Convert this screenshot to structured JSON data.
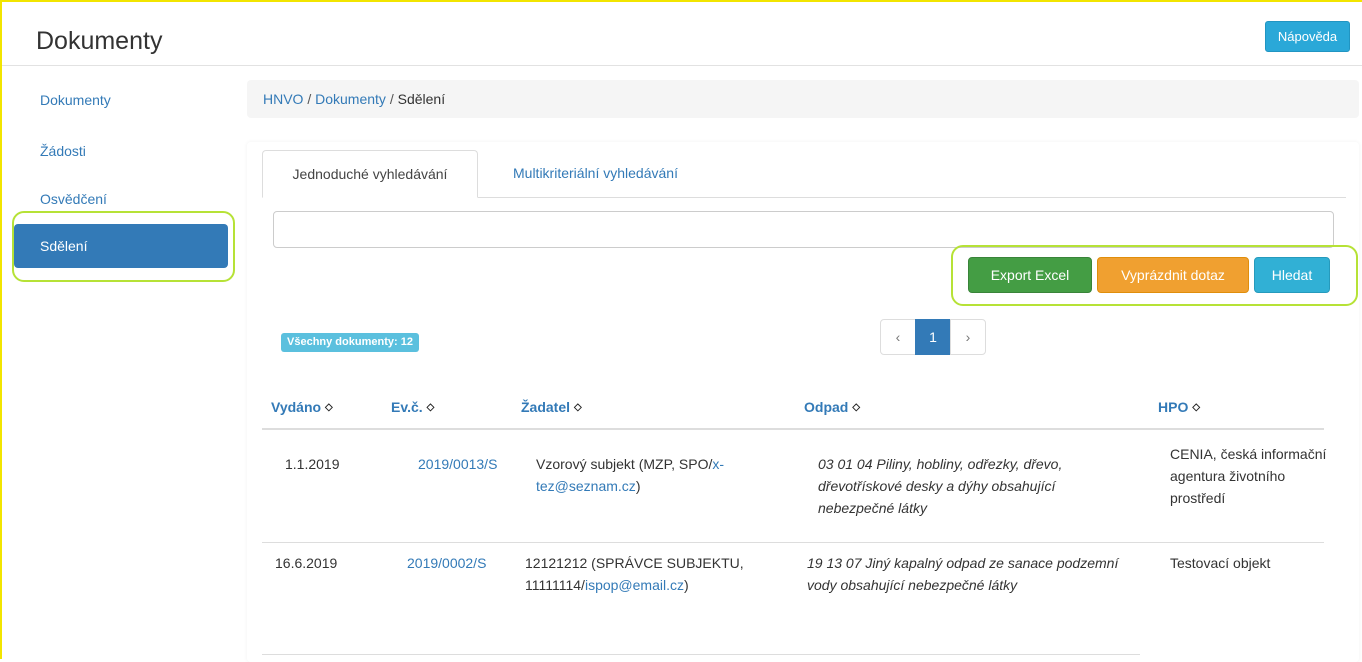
{
  "header": {
    "title": "Dokumenty",
    "help_label": "Nápověda"
  },
  "sidebar": {
    "items": [
      {
        "label": "Dokumenty"
      },
      {
        "label": "Žádosti"
      },
      {
        "label": "Osvědčení"
      },
      {
        "label": "Sdělení"
      }
    ]
  },
  "breadcrumb": {
    "root": "HNVO",
    "sep1": "/",
    "parent": "Dokumenty",
    "sep2": "/",
    "current": "Sdělení"
  },
  "tabs": [
    {
      "label": "Jednoduché vyhledávání",
      "active": true
    },
    {
      "label": "Multikriteriální vyhledávání",
      "active": false
    }
  ],
  "search": {
    "value": "",
    "placeholder": ""
  },
  "buttons": {
    "export": "Export Excel",
    "clear": "Vyprázdnit dotaz",
    "search": "Hledat"
  },
  "count_badge": "Všechny dokumenty: 12",
  "pagination": {
    "prev": "‹",
    "current": "1",
    "next": "›"
  },
  "table": {
    "columns": [
      "Vydáno",
      "Ev.č.",
      "Žadatel",
      "Odpad",
      "HPO"
    ],
    "sort_icon": "◇",
    "rows": [
      {
        "vydano": "1.1.2019",
        "evc": "2019/0013/S",
        "zadatel_text": "Vzorový subjekt (MZP, SPO/",
        "zadatel_email": "x-tez@seznam.cz",
        "zadatel_end": ")",
        "odpad": "03 01 04 Piliny, hobliny, odřezky, dřevo, dřevotřískové desky a dýhy obsahující nebezpečné látky",
        "hpo": "CENIA, česká informační agentura životního prostředí"
      },
      {
        "vydano": "16.6.2019",
        "evc": "2019/0002/S",
        "zadatel_text": "12121212 (SPRÁVCE SUBJEKTU, 11111114/",
        "zadatel_email": "ispop@email.cz",
        "zadatel_end": ")",
        "odpad": "19 13 07 Jiný kapalný odpad ze sanace podzemní vody obsahující nebezpečné látky",
        "hpo": "Testovací objekt"
      }
    ]
  },
  "colors": {
    "primary": "#337ab7",
    "success": "#449d44",
    "warning": "#f0a030",
    "info": "#31b0d5",
    "highlight": "#b6e236",
    "frame": "#f2e500"
  }
}
